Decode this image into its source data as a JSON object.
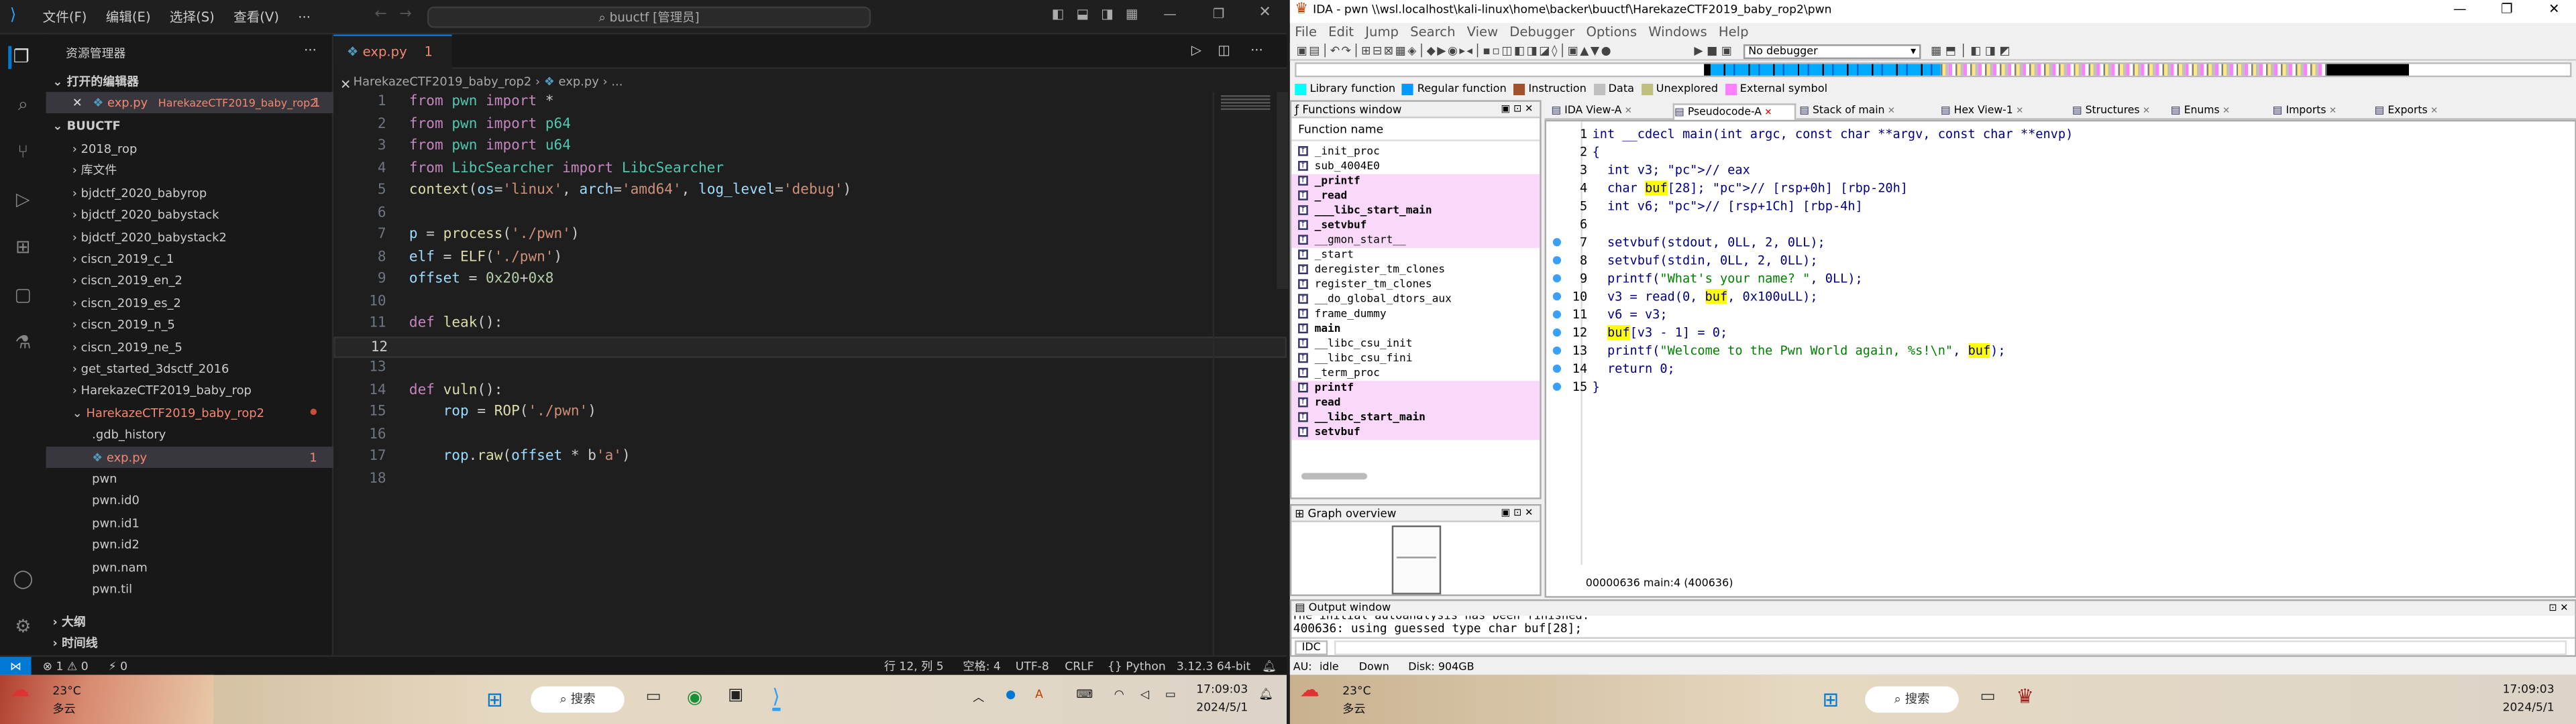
{
  "vscode": {
    "menu": [
      "文件(F)",
      "编辑(E)",
      "选择(S)",
      "查看(V)",
      "···"
    ],
    "command_center": "buuctf [管理员]",
    "sidebar_title": "资源管理器",
    "open_editors_label": "打开的编辑器",
    "open_editor": {
      "name": "exp.py",
      "path": "HarekazeCTF2019_baby_rop2",
      "count": "1"
    },
    "folder": "BUUCTF",
    "tree": [
      {
        "label": "2018_rop",
        "type": "folder"
      },
      {
        "label": "库文件",
        "type": "folder"
      },
      {
        "label": "bjdctf_2020_babyrop",
        "type": "folder"
      },
      {
        "label": "bjdctf_2020_babystack",
        "type": "folder"
      },
      {
        "label": "bjdctf_2020_babystack2",
        "type": "folder"
      },
      {
        "label": "ciscn_2019_c_1",
        "type": "folder"
      },
      {
        "label": "ciscn_2019_en_2",
        "type": "folder"
      },
      {
        "label": "ciscn_2019_es_2",
        "type": "folder"
      },
      {
        "label": "ciscn_2019_n_5",
        "type": "folder"
      },
      {
        "label": "ciscn_2019_ne_5",
        "type": "folder"
      },
      {
        "label": "get_started_3dsctf_2016",
        "type": "folder"
      },
      {
        "label": "HarekazeCTF2019_baby_rop",
        "type": "folder"
      },
      {
        "label": "HarekazeCTF2019_baby_rop2",
        "type": "open"
      },
      {
        "label": ".gdb_history",
        "type": "file"
      },
      {
        "label": "exp.py",
        "type": "py",
        "badge": "1"
      },
      {
        "label": "pwn",
        "type": "file"
      },
      {
        "label": "pwn.id0",
        "type": "file"
      },
      {
        "label": "pwn.id1",
        "type": "file"
      },
      {
        "label": "pwn.id2",
        "type": "file"
      },
      {
        "label": "pwn.nam",
        "type": "file"
      },
      {
        "label": "pwn.til",
        "type": "file"
      }
    ],
    "outline_label": "大纲",
    "timeline_label": "时间线",
    "tab": {
      "name": "exp.py",
      "badge": "1"
    },
    "breadcrumb": [
      "HarekazeCTF2019_baby_rop2",
      "exp.py",
      "..."
    ],
    "code_lines": [
      "from pwn import *",
      "from pwn import p64",
      "from pwn import u64",
      "from LibcSearcher import LibcSearcher",
      "context(os='linux', arch='amd64', log_level='debug')",
      "",
      "p = process('./pwn')",
      "elf = ELF('./pwn')",
      "offset = 0x20+0x8",
      "",
      "def leak():",
      "",
      "",
      "def vuln():",
      "    rop = ROP('./pwn')",
      "",
      "    rop.raw(offset * b'a')",
      ""
    ],
    "status": {
      "errors": "1",
      "warnings": "0",
      "ports": "0",
      "position": "行 12, 列 5",
      "spaces": "空格: 4",
      "encoding": "UTF-8",
      "eol": "CRLF",
      "language": "Python",
      "interpreter": "3.12.3 64-bit"
    }
  },
  "ida": {
    "title": "IDA - pwn \\\\wsl.localhost\\kali-linux\\home\\backer\\buuctf\\HarekazeCTF2019_baby_rop2\\pwn",
    "menu": [
      "File",
      "Edit",
      "Jump",
      "Search",
      "View",
      "Debugger",
      "Options",
      "Windows",
      "Help"
    ],
    "debugger": "No debugger",
    "legend": [
      "Library function",
      "Regular function",
      "Instruction",
      "Data",
      "Unexplored",
      "External symbol"
    ],
    "functions_title": "Functions window",
    "function_name_header": "Function name",
    "functions": [
      {
        "name": "_init_proc",
        "bold": false,
        "hl": false
      },
      {
        "name": "sub_4004E0",
        "bold": false,
        "hl": false
      },
      {
        "name": "_printf",
        "bold": true,
        "hl": true
      },
      {
        "name": "_read",
        "bold": true,
        "hl": true
      },
      {
        "name": "___libc_start_main",
        "bold": true,
        "hl": true
      },
      {
        "name": "_setvbuf",
        "bold": true,
        "hl": true
      },
      {
        "name": "__gmon_start__",
        "bold": false,
        "hl": true
      },
      {
        "name": "_start",
        "bold": false,
        "hl": false
      },
      {
        "name": "deregister_tm_clones",
        "bold": false,
        "hl": false
      },
      {
        "name": "register_tm_clones",
        "bold": false,
        "hl": false
      },
      {
        "name": "__do_global_dtors_aux",
        "bold": false,
        "hl": false
      },
      {
        "name": "frame_dummy",
        "bold": false,
        "hl": false
      },
      {
        "name": "main",
        "bold": true,
        "hl": false
      },
      {
        "name": "__libc_csu_init",
        "bold": false,
        "hl": false
      },
      {
        "name": "__libc_csu_fini",
        "bold": false,
        "hl": false
      },
      {
        "name": "_term_proc",
        "bold": false,
        "hl": false
      },
      {
        "name": "printf",
        "bold": true,
        "hl": true
      },
      {
        "name": "read",
        "bold": true,
        "hl": true
      },
      {
        "name": "__libc_start_main",
        "bold": true,
        "hl": true
      },
      {
        "name": "setvbuf",
        "bold": true,
        "hl": true
      }
    ],
    "tabs": [
      "IDA View-A",
      "Pseudocode-A",
      "Stack of main",
      "Hex View-1",
      "Structures",
      "Enums",
      "Imports",
      "Exports"
    ],
    "graph_title": "Graph overview",
    "pseudocode": [
      {
        "n": "1",
        "t": "int __cdecl main(int argc, const char **argv, const char **envp)"
      },
      {
        "n": "2",
        "t": "{"
      },
      {
        "n": "3",
        "t": "  int v3; // eax"
      },
      {
        "n": "4",
        "t": "  char buf[28]; // [rsp+0h] [rbp-20h]"
      },
      {
        "n": "5",
        "t": "  int v6; // [rsp+1Ch] [rbp-4h]"
      },
      {
        "n": "6",
        "t": ""
      },
      {
        "n": "7",
        "t": "  setvbuf(stdout, 0LL, 2, 0LL);"
      },
      {
        "n": "8",
        "t": "  setvbuf(stdin, 0LL, 2, 0LL);"
      },
      {
        "n": "9",
        "t": "  printf(\"What's your name? \", 0LL);"
      },
      {
        "n": "10",
        "t": "  v3 = read(0, buf, 0x100uLL);"
      },
      {
        "n": "11",
        "t": "  v6 = v3;"
      },
      {
        "n": "12",
        "t": "  buf[v3 - 1] = 0;"
      },
      {
        "n": "13",
        "t": "  printf(\"Welcome to the Pwn World again, %s!\\n\", buf);"
      },
      {
        "n": "14",
        "t": "  return 0;"
      },
      {
        "n": "15",
        "t": "}"
      }
    ],
    "pseudo_status": "00000636 main:4 (400636)",
    "output_title": "Output window",
    "output_lines": [
      "The initial autoanalysis has been finished.",
      "400636: using guessed type char buf[28];"
    ],
    "idc_label": "IDC",
    "status_bar": {
      "au": "AU:",
      "state": "idle",
      "dir": "Down",
      "disk": "Disk: 904GB"
    }
  },
  "taskbar": {
    "weather_temp": "23°C",
    "weather_desc": "多云",
    "search_label": "搜索",
    "time": "17:09:03",
    "date": "2024/5/1"
  }
}
